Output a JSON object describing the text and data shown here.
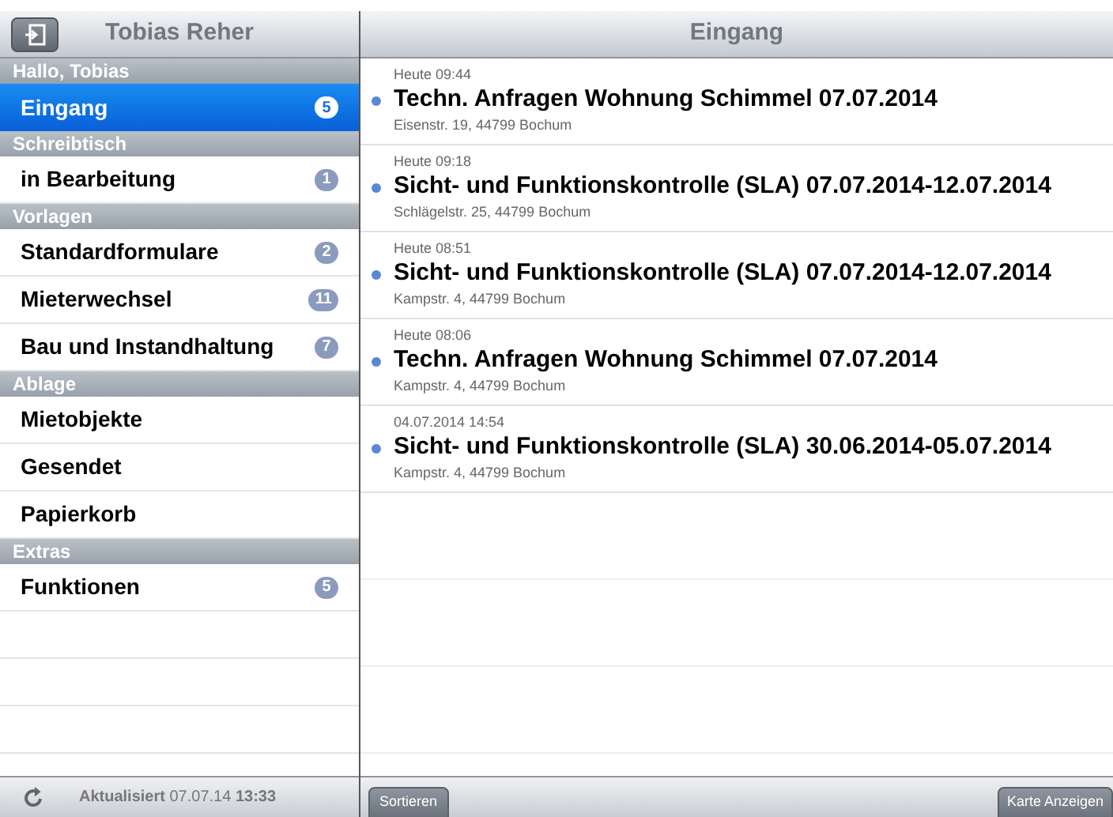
{
  "sidebar": {
    "title": "Tobias Reher",
    "sections": [
      {
        "title": "Hallo, Tobias",
        "items": [
          {
            "label": "Eingang",
            "badge": "5",
            "selected": true
          }
        ]
      },
      {
        "title": "Schreibtisch",
        "items": [
          {
            "label": "in Bearbeitung",
            "badge": "1",
            "selected": false
          }
        ]
      },
      {
        "title": "Vorlagen",
        "items": [
          {
            "label": "Standardformulare",
            "badge": "2",
            "selected": false
          },
          {
            "label": "Mieterwechsel",
            "badge": "11",
            "selected": false
          },
          {
            "label": "Bau und Instandhaltung",
            "badge": "7",
            "selected": false
          }
        ]
      },
      {
        "title": "Ablage",
        "items": [
          {
            "label": "Mietobjekte",
            "selected": false
          },
          {
            "label": "Gesendet",
            "selected": false
          },
          {
            "label": "Papierkorb",
            "selected": false
          }
        ]
      },
      {
        "title": "Extras",
        "items": [
          {
            "label": "Funktionen",
            "badge": "5",
            "selected": false
          }
        ]
      }
    ],
    "footer": {
      "label": "Aktualisiert",
      "date": "07.07.14",
      "time": "13:33"
    }
  },
  "main": {
    "title": "Eingang",
    "messages": [
      {
        "time": "Heute 09:44",
        "title": "Techn. Anfragen Wohnung Schimmel 07.07.2014",
        "address": "Eisenstr. 19, 44799 Bochum",
        "unread": true
      },
      {
        "time": "Heute 09:18",
        "title": "Sicht- und Funktionskontrolle (SLA) 07.07.2014-12.07.2014",
        "address": "Schlägelstr. 25, 44799 Bochum",
        "unread": true
      },
      {
        "time": "Heute 08:51",
        "title": "Sicht- und Funktionskontrolle (SLA) 07.07.2014-12.07.2014",
        "address": "Kampstr. 4, 44799 Bochum",
        "unread": true
      },
      {
        "time": "Heute 08:06",
        "title": "Techn. Anfragen Wohnung Schimmel 07.07.2014",
        "address": "Kampstr. 4, 44799 Bochum",
        "unread": true
      },
      {
        "time": "04.07.2014 14:54",
        "title": "Sicht- und Funktionskontrolle (SLA) 30.06.2014-05.07.2014",
        "address": "Kampstr. 4, 44799 Bochum",
        "unread": true
      }
    ],
    "toolbar": {
      "left_button": "Sortieren",
      "right_button": "Karte Anzeigen"
    }
  }
}
